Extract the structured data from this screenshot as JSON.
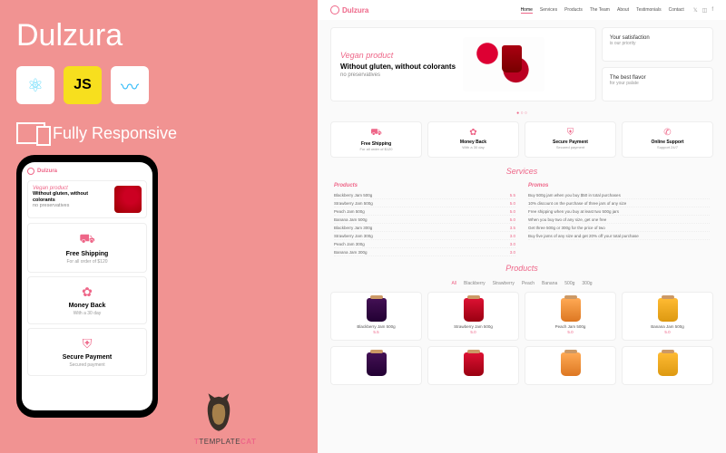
{
  "promo": {
    "title": "Dulzura",
    "responsive": "Fully Responsive",
    "templatecat": "TEMPLATE"
  },
  "phone": {
    "logo": "Dulzura",
    "vegan": "Vegan product",
    "headline": "Without gluten, without colorants",
    "sub": "no preservatives",
    "cards": [
      {
        "icon": "⛟",
        "t": "Free Shipping",
        "s": "For all order of $120"
      },
      {
        "icon": "✿",
        "t": "Money Back",
        "s": "With a 30 day"
      },
      {
        "icon": "⛨",
        "t": "Secure Payment",
        "s": "Secured payment"
      }
    ]
  },
  "nav": {
    "logo": "Dulzura",
    "links": [
      "Home",
      "Services",
      "Products",
      "The Team",
      "About",
      "Testimonials",
      "Contact"
    ]
  },
  "hero": {
    "vegan": "Vegan product",
    "h1": "Without gluten, without colorants",
    "sub": "no preservatives",
    "side1a": "Your satisfaction",
    "side1b": "is our priority",
    "side2a": "The best flavor",
    "side2b": "for your palate"
  },
  "features": [
    {
      "icon": "⛟",
      "t": "Free Shipping",
      "s": "For all order of $120"
    },
    {
      "icon": "✿",
      "t": "Money Back",
      "s": "With a 30 day"
    },
    {
      "icon": "⛨",
      "t": "Secure Payment",
      "s": "Secured payment"
    },
    {
      "icon": "✆",
      "t": "Online Support",
      "s": "Support 24/7"
    }
  ],
  "services": {
    "heading": "Services",
    "col1_h": "Products",
    "col1": [
      {
        "n": "Blackberry Jam 500g",
        "p": "5.5"
      },
      {
        "n": "Strawberry Jam 500g",
        "p": "5.0"
      },
      {
        "n": "Peach Jam 500g",
        "p": "5.0"
      },
      {
        "n": "Banana Jam 500g",
        "p": "5.0"
      },
      {
        "n": "Blackberry Jam 300g",
        "p": "3.5"
      },
      {
        "n": "Strawberry Jam 300g",
        "p": "3.0"
      },
      {
        "n": "Peach Jam 300g",
        "p": "3.0"
      },
      {
        "n": "Banana Jam 300g",
        "p": "3.0"
      }
    ],
    "col2_h": "Promos",
    "col2": [
      {
        "n": "Buy 500g jam when you buy $50 in total purchases"
      },
      {
        "n": "10% discount on the purchase of three jars of any size"
      },
      {
        "n": "Free shipping when you buy at least two 500g jars"
      },
      {
        "n": "When you buy two of any size, get one free"
      },
      {
        "n": "Get three 500g or 300g for the price of two"
      },
      {
        "n": "Buy five jams of any size and get 20% off your total purchase"
      }
    ]
  },
  "products": {
    "heading": "Products",
    "filters": [
      "All",
      "Blackberry",
      "Strawberry",
      "Peach",
      "Banana",
      "500g",
      "300g"
    ],
    "row1": [
      {
        "c": "bb",
        "t": "Blackberry Jam 500g",
        "p": "5.5"
      },
      {
        "c": "st",
        "t": "Strawberry Jam 500g",
        "p": "5.0"
      },
      {
        "c": "pe",
        "t": "Peach Jam 500g",
        "p": "5.0"
      },
      {
        "c": "ba",
        "t": "Banana Jam 500g",
        "p": "5.0"
      }
    ],
    "row2": [
      {
        "c": "bb"
      },
      {
        "c": "st"
      },
      {
        "c": "pe"
      },
      {
        "c": "ba"
      }
    ]
  }
}
